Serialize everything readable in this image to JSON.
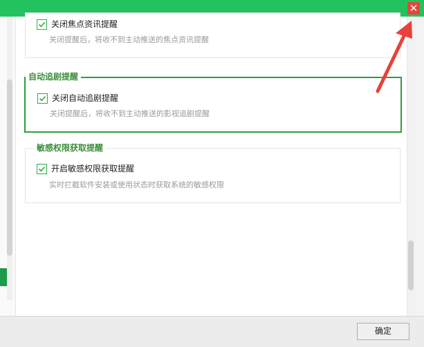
{
  "window": {
    "close_glyph": "✕",
    "accent_color": "#22c35e"
  },
  "groups": [
    {
      "title": "",
      "checkbox_label": "关闭焦点资讯提醒",
      "checked": true,
      "description": "关闭提醒后，将收不到主动推送的焦点资讯提醒"
    },
    {
      "title": "自动追剧提醒",
      "checkbox_label": "关闭自动追剧提醒",
      "checked": true,
      "description": "关闭提醒后，将收不到主动推送的影视追剧提醒"
    },
    {
      "title": "敏感权限获取提醒",
      "checkbox_label": "开启敏感权限获取提醒",
      "checked": true,
      "description": "实时拦截软件安装或使用状态时获取系统的敏感权限"
    }
  ],
  "footer": {
    "ok_label": "确定"
  },
  "annotation": {
    "arrow_color": "#e8403a"
  }
}
